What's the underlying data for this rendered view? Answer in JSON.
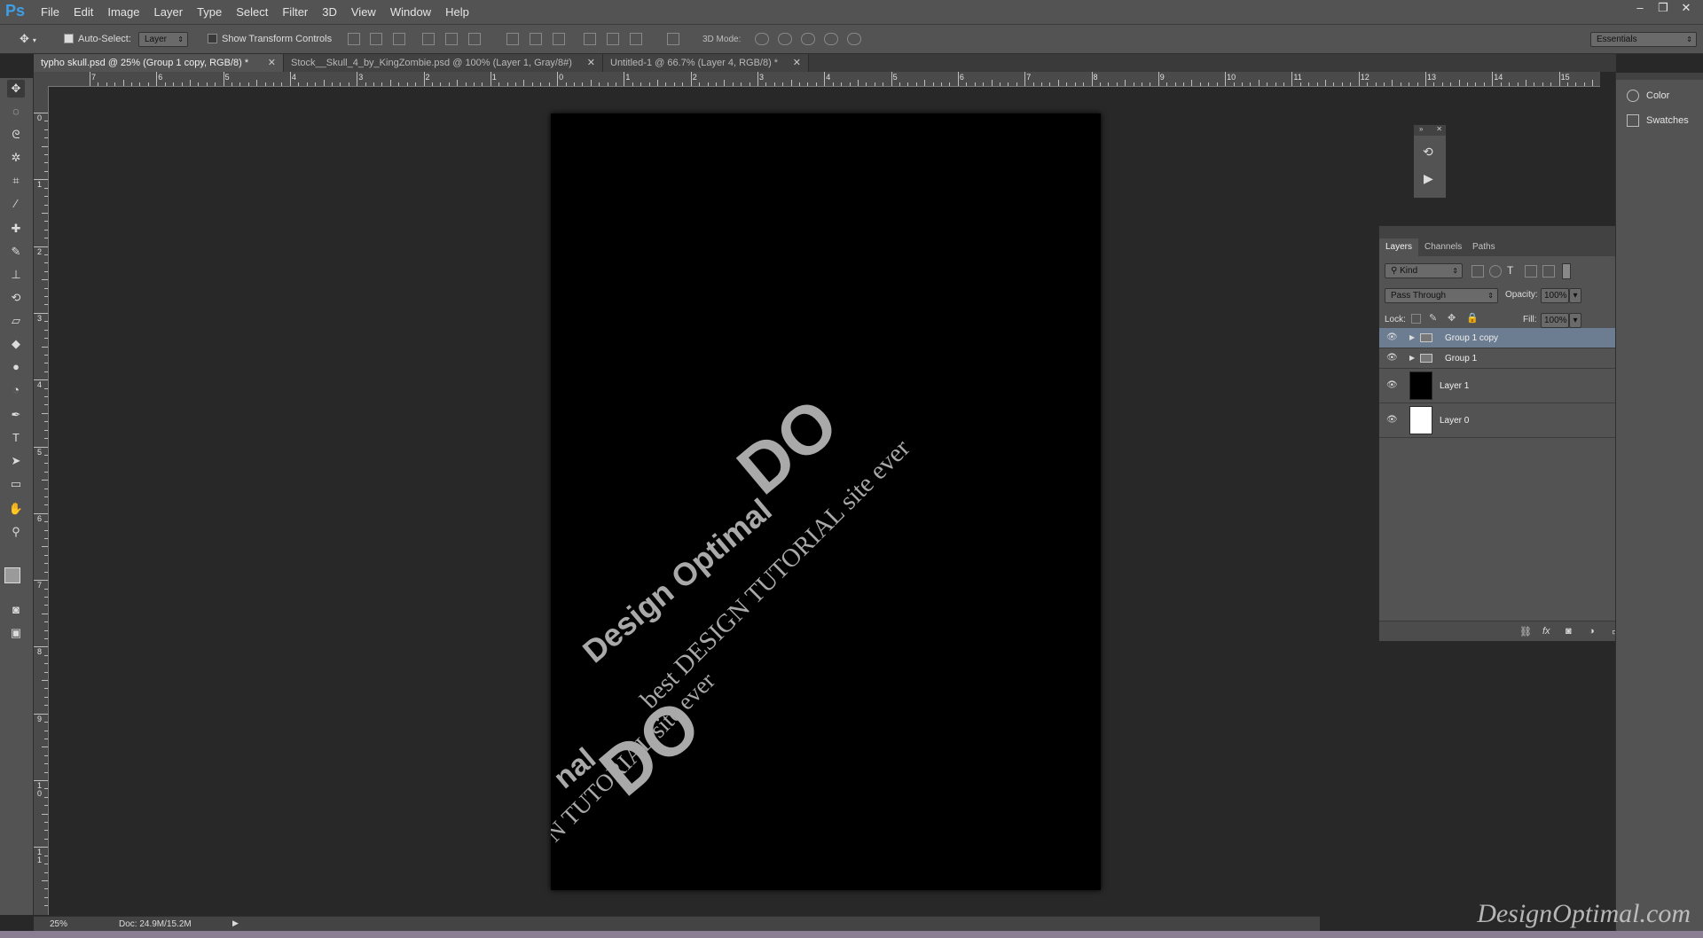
{
  "app": {
    "logo": "Ps"
  },
  "menu": [
    "File",
    "Edit",
    "Image",
    "Layer",
    "Type",
    "Select",
    "Filter",
    "3D",
    "View",
    "Window",
    "Help"
  ],
  "window_controls": {
    "minimize": "–",
    "restore": "❐",
    "close": "✕"
  },
  "options": {
    "auto_select_label": "Auto-Select:",
    "auto_select_checked": true,
    "auto_select_target": "Layer",
    "show_transform_label": "Show Transform Controls",
    "show_transform_checked": false,
    "mode_3d_label": "3D Mode:",
    "workspace": "Essentials"
  },
  "doc_tabs": [
    {
      "label": "typho skull.psd @ 25% (Group 1 copy, RGB/8) *",
      "active": true
    },
    {
      "label": "Stock__Skull_4_by_KingZombie.psd @ 100% (Layer 1, Gray/8#)",
      "active": false
    },
    {
      "label": "Untitled-1 @ 66.7% (Layer 4, RGB/8) *",
      "active": false
    }
  ],
  "ruler_h": [
    "7",
    "6",
    "5",
    "4",
    "3",
    "2",
    "1",
    "0",
    "1",
    "2",
    "3",
    "4",
    "5",
    "6",
    "7",
    "8",
    "9",
    "10",
    "11",
    "12",
    "13",
    "14",
    "15"
  ],
  "ruler_v": [
    "0",
    "1",
    "2",
    "3",
    "4",
    "5",
    "6",
    "7",
    "8",
    "9",
    "1\n0",
    "1\n1"
  ],
  "canvas_text": {
    "line_do_1": "DO",
    "line_design_1": "Design Optimal",
    "line_tagline_1": "best DESIGN TUTORIAL site ever",
    "line_do_2": "DO",
    "line_design_2": "nal",
    "line_tagline_2": "N TUTORIAL site ever"
  },
  "status": {
    "zoom": "25%",
    "doc": "Doc: 24.9M/15.2M"
  },
  "dock": [
    {
      "label": "Color",
      "icon": "color-palette-icon"
    },
    {
      "label": "Swatches",
      "icon": "swatches-grid-icon"
    }
  ],
  "layers_panel": {
    "tabs": [
      {
        "label": "Layers",
        "active": true
      },
      {
        "label": "Channels",
        "active": false
      },
      {
        "label": "Paths",
        "active": false
      }
    ],
    "filter_kind": "Kind",
    "blend_mode": "Pass Through",
    "opacity_label": "Opacity:",
    "opacity": "100%",
    "lock_label": "Lock:",
    "fill_label": "Fill:",
    "fill": "100%",
    "layers": [
      {
        "name": "Group 1 copy",
        "type": "group",
        "selected": true,
        "visible": true
      },
      {
        "name": "Group 1",
        "type": "group",
        "selected": false,
        "visible": true
      },
      {
        "name": "Layer 1",
        "type": "pixel",
        "thumb": "#000000",
        "selected": false,
        "visible": true
      },
      {
        "name": "Layer 0",
        "type": "pixel",
        "thumb": "#ffffff",
        "selected": false,
        "visible": true
      }
    ]
  },
  "watermark": "DesignOptimal.com"
}
